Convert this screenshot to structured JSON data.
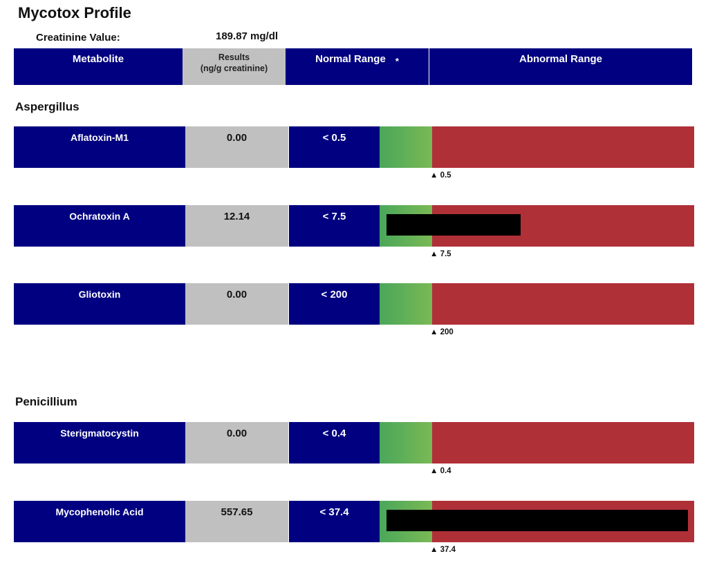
{
  "report": {
    "title": "Mycotox Profile",
    "creatinine_label": "Creatinine Value:",
    "creatinine_value": "189.87 mg/dl"
  },
  "header": {
    "metabolite": "Metabolite",
    "results_line1": "Results",
    "results_line2": "(ng/g creatinine)",
    "normal_range": "Normal Range",
    "normal_range_note": "*",
    "abnormal_range": "Abnormal Range"
  },
  "colors": {
    "navy": "#000080",
    "result_grey": "#c0c0c0",
    "normal_green_start": "#4aa75a",
    "normal_green_end": "#7ab955",
    "abnormal_red": "#b03038",
    "redaction": "#000000"
  },
  "sections": [
    {
      "name": "Aspergillus",
      "rows": [
        {
          "metabolite": "Aflatoxin-M1",
          "result": "0.00",
          "range": "< 0.5",
          "marker": "▲ 0.5",
          "redacted": false
        },
        {
          "metabolite": "Ochratoxin A",
          "result": "12.14",
          "range": "< 7.5",
          "marker": "▲ 7.5",
          "redacted": true
        },
        {
          "metabolite": "Gliotoxin",
          "result": "0.00",
          "range": "< 200",
          "marker": "▲ 200",
          "redacted": false
        }
      ]
    },
    {
      "name": "Penicillium",
      "rows": [
        {
          "metabolite": "Sterigmatocystin",
          "result": "0.00",
          "range": "< 0.4",
          "marker": "▲ 0.4",
          "redacted": false
        },
        {
          "metabolite": "Mycophenolic Acid",
          "result": "557.65",
          "range": "< 37.4",
          "marker": "▲ 37.4",
          "redacted": true
        }
      ]
    }
  ]
}
